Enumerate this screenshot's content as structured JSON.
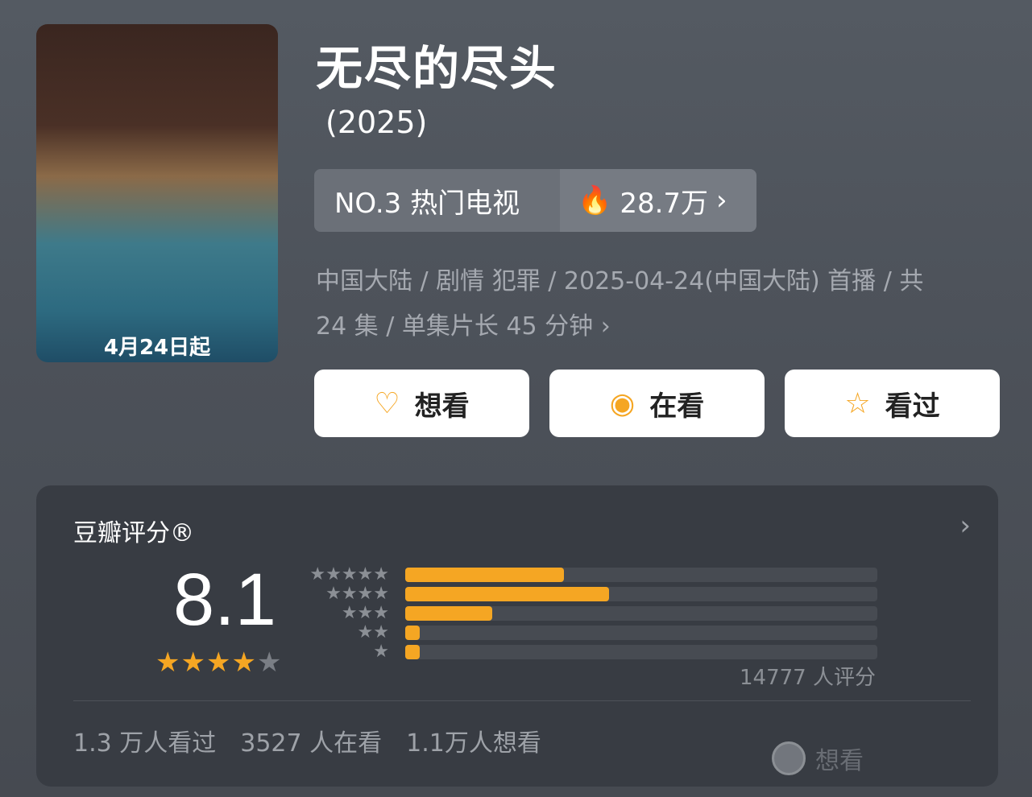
{
  "poster": {
    "caption": "4月24日起"
  },
  "title": "无尽的尽头",
  "year": "(2025)",
  "rank": {
    "label": "NO.3 热门电视",
    "heat": "28.7万"
  },
  "meta": {
    "line1": "中国大陆 / 剧情 犯罪 / 2025-04-24(中国大陆) 首播 / 共",
    "line2": "24 集 / 单集片长 45 分钟"
  },
  "actions": [
    {
      "label": "想看",
      "icon": "heart-plus-icon"
    },
    {
      "label": "在看",
      "icon": "target-icon"
    },
    {
      "label": "看过",
      "icon": "star-outline-icon"
    }
  ],
  "rating": {
    "title": "豆瓣评分®",
    "score": "8.1",
    "stars_filled": 4,
    "stars_total": 5,
    "distribution": [
      {
        "stars": 5,
        "fraction": 0.337
      },
      {
        "stars": 4,
        "fraction": 0.432
      },
      {
        "stars": 3,
        "fraction": 0.185
      },
      {
        "stars": 2,
        "fraction": 0.03
      },
      {
        "stars": 1,
        "fraction": 0.03
      }
    ],
    "count_text": "14777 人评分"
  },
  "stats": {
    "watched": "1.3 万人看过",
    "watching": "3527 人在看",
    "want": "1.1万人想看"
  },
  "watermark": "想看",
  "colors": {
    "accent": "#f5a623",
    "background": "#4c5159",
    "card": "#383c43"
  }
}
